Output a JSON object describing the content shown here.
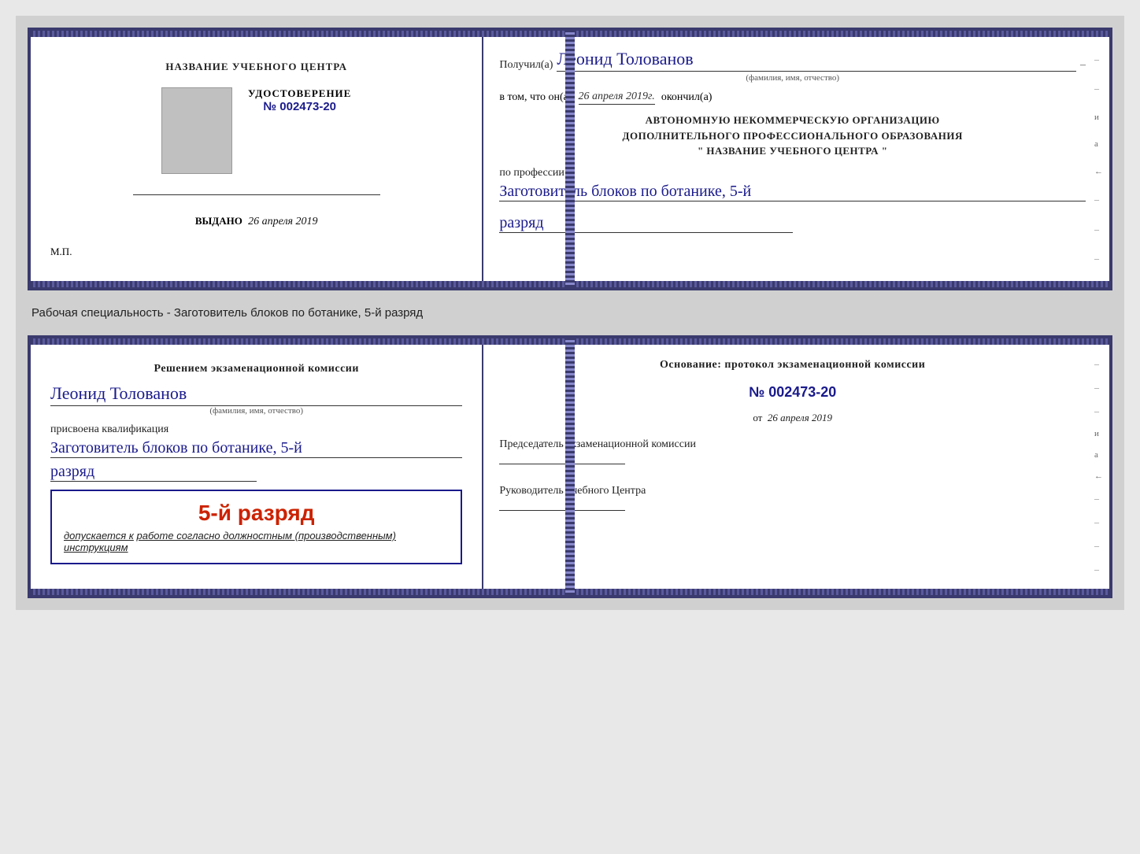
{
  "page": {
    "background": "#d0d0d0"
  },
  "card1": {
    "left": {
      "title1": "НАЗВАНИЕ УЧЕБНОГО ЦЕНТРА",
      "cert_label": "УДОСТОВЕРЕНИЕ",
      "cert_prefix": "№",
      "cert_number": "002473-20",
      "issued_prefix": "Выдано",
      "issued_date": "26 апреля 2019",
      "mp_label": "М.П."
    },
    "right": {
      "received_label": "Получил(а)",
      "recipient_name": "Леонид Толованов",
      "fio_hint": "(фамилия, имя, отчество)",
      "date_prefix": "в том, что он(а)",
      "date_value": "26 апреля 2019г.",
      "date_suffix": "окончил(а)",
      "institution_line1": "АВТОНОМНУЮ НЕКОММЕРЧЕСКУЮ ОРГАНИЗАЦИЮ",
      "institution_line2": "ДОПОЛНИТЕЛЬНОГО ПРОФЕССИОНАЛЬНОГО ОБРАЗОВАНИЯ",
      "institution_line3": "\" НАЗВАНИЕ УЧЕБНОГО ЦЕНТРА \"",
      "profession_label": "по профессии",
      "profession_value": "Заготовитель блоков по ботанике, 5-й",
      "rank_value": "разряд"
    }
  },
  "specialty_label": "Рабочая специальность - Заготовитель блоков по ботанике, 5-й разряд",
  "card2": {
    "left": {
      "decision_text": "Решением экзаменационной комиссии",
      "recipient_name": "Леонид Толованов",
      "fio_hint": "(фамилия, имя, отчество)",
      "qualification_label": "присвоена квалификация",
      "profession_value": "Заготовитель блоков по ботанике, 5-й",
      "rank_value": "разряд",
      "rank_box_text": "5-й разряд",
      "allowed_prefix": "допускается к",
      "allowed_text": "работе согласно должностным (производственным) инструкциям"
    },
    "right": {
      "basis_title": "Основание: протокол экзаменационной комиссии",
      "protocol_prefix": "№",
      "protocol_number": "002473-20",
      "date_prefix": "от",
      "date_value": "26 апреля 2019",
      "chairman_label": "Председатель экзаменационной комиссии",
      "director_label": "Руководитель учебного Центра"
    }
  }
}
